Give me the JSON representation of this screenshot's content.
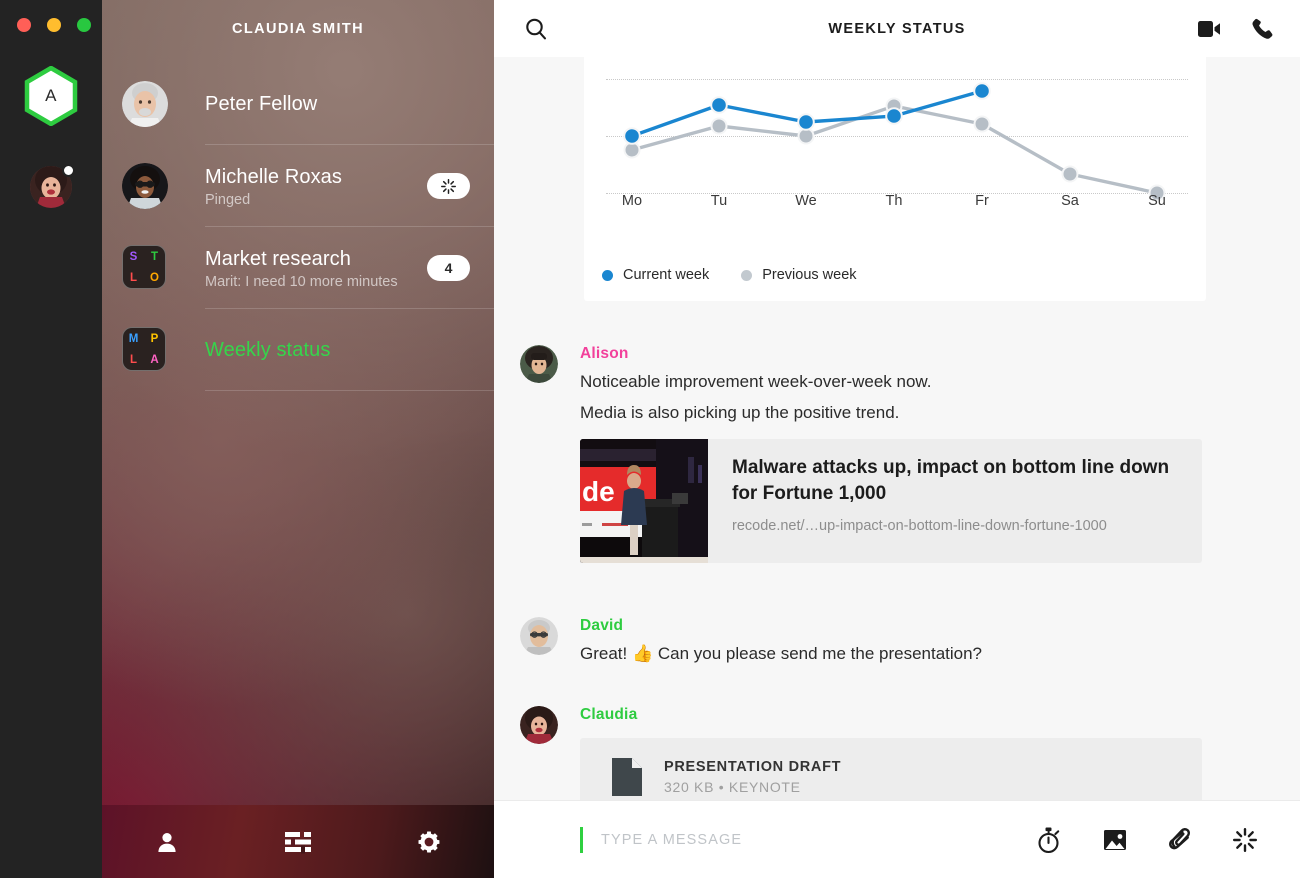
{
  "window": {
    "traffic_lights": [
      "close",
      "minimize",
      "zoom"
    ],
    "colors": {
      "close": "#ff5f57",
      "minimize": "#ffbd2e",
      "zoom": "#28c840"
    }
  },
  "rail": {
    "team_badge_letter": "A",
    "team_badge_color": "#2ecc40",
    "user_avatar_name": "claudia-avatar",
    "user_status": "online"
  },
  "sidebar": {
    "title": "CLAUDIA SMITH",
    "conversations": [
      {
        "name": "Peter Fellow",
        "subtitle": "",
        "avatar_type": "photo",
        "badge": "",
        "selected": false
      },
      {
        "name": "Michelle Roxas",
        "subtitle": "Pinged",
        "avatar_type": "photo",
        "badge": "ping-icon",
        "selected": false
      },
      {
        "name": "Market research",
        "subtitle": "Marit: I need 10 more minutes",
        "avatar_type": "group",
        "group_letters": [
          {
            "char": "S",
            "color": "#a259ff"
          },
          {
            "char": "T",
            "color": "#2ecc40"
          },
          {
            "char": "L",
            "color": "#ff4d4d"
          },
          {
            "char": "O",
            "color": "#ffa800"
          }
        ],
        "badge": "4",
        "selected": false
      },
      {
        "name": "Weekly status",
        "subtitle": "",
        "avatar_type": "group",
        "group_letters": [
          {
            "char": "M",
            "color": "#3aa0ff"
          },
          {
            "char": "P",
            "color": "#ffc400"
          },
          {
            "char": "L",
            "color": "#ff4d4d"
          },
          {
            "char": "A",
            "color": "#ff63c3"
          }
        ],
        "badge": "",
        "selected": true
      }
    ],
    "selected_color": "#35d54b",
    "toolbar": [
      {
        "icon": "person-icon",
        "label": "Contacts"
      },
      {
        "icon": "sliders-icon",
        "label": "Filters"
      },
      {
        "icon": "gear-icon",
        "label": "Settings"
      }
    ]
  },
  "header": {
    "title": "WEEKLY STATUS",
    "search_icon": "search-icon",
    "video_call_icon": "video-call-icon",
    "voice_call_icon": "phone-icon"
  },
  "chart_data": {
    "type": "line",
    "title": "",
    "xlabel": "",
    "ylabel": "",
    "categories": [
      "Mo",
      "Tu",
      "We",
      "Th",
      "Fr",
      "Sa",
      "Su"
    ],
    "grid": true,
    "gridlines": [
      3,
      2,
      0
    ],
    "ylim": [
      0,
      3
    ],
    "legend_position": "bottom-left",
    "series": [
      {
        "name": "Current week",
        "color": "#1a86d0",
        "values": [
          1.78,
          2.68,
          2.22,
          2.37,
          3.0,
          null,
          null
        ]
      },
      {
        "name": "Previous week",
        "color": "#b6bec6",
        "values": [
          1.52,
          2.25,
          1.95,
          2.78,
          2.3,
          0.85,
          0.45
        ]
      }
    ]
  },
  "messages": [
    {
      "author": "Alison",
      "author_color": "#f2409b",
      "avatar": "alison-avatar",
      "lines": [
        "Noticeable improvement week-over-week now.",
        "Media is also picking up the positive trend."
      ],
      "attachment": {
        "type": "link",
        "title": "Malware attacks up, impact on bottom line down for Fortune 1,000",
        "url": "recode.net/…up-impact-on-bottom-line-down-fortune-1000",
        "thumb": "conference-stage-photo"
      }
    },
    {
      "author": "David",
      "author_color": "#2ecc40",
      "avatar": "david-avatar",
      "lines": [
        "Great! 👍 Can you please send me the presentation?"
      ],
      "attachment": null
    },
    {
      "author": "Claudia",
      "author_color": "#2ecc40",
      "avatar": "claudia-avatar",
      "lines": [],
      "attachment": {
        "type": "file",
        "name": "PRESENTATION DRAFT",
        "meta": "320 KB • KEYNOTE",
        "icon": "document-icon"
      }
    }
  ],
  "composer": {
    "placeholder": "TYPE A MESSAGE",
    "value": "",
    "caret_color": "#2fd040",
    "icons": [
      {
        "icon": "timer-icon",
        "label": "Timed message"
      },
      {
        "icon": "image-icon",
        "label": "Send image"
      },
      {
        "icon": "paperclip-icon",
        "label": "Attach file"
      },
      {
        "icon": "ping-icon",
        "label": "Ping"
      }
    ]
  }
}
